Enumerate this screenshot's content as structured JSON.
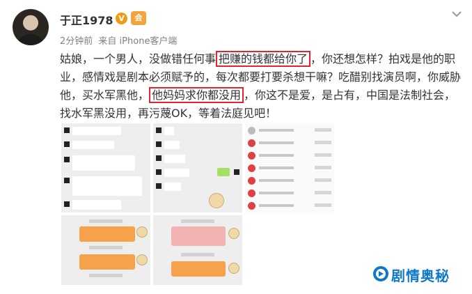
{
  "post": {
    "author": "于正1978",
    "verified_badge": "V",
    "vip_badge": "会",
    "time": "2分钟前",
    "source": "来自 iPhone客户端",
    "text_parts": [
      "姑娘，一个男人，没做错任何事",
      "把赚的钱都给你了",
      "，你还想怎样？拍戏是他的职业，感情戏是剧本必须赋予的，每次都要打要杀想干嘛？吃醋别找演员啊，你威胁他，买水军黑他，",
      "他妈妈求你都没用",
      "，你这不是爱，是占有，中国是法制社会，找水军黑没用，再污蔑OK，等着法庭见吧！"
    ]
  },
  "icons": {
    "more": "chevron-down-icon",
    "brand": "play-circle-icon"
  },
  "watermark": {
    "text": "剧情奥秘"
  },
  "colors": {
    "highlight": "#e0252e",
    "brand": "#0f79c9",
    "badge": "#f29a13"
  }
}
